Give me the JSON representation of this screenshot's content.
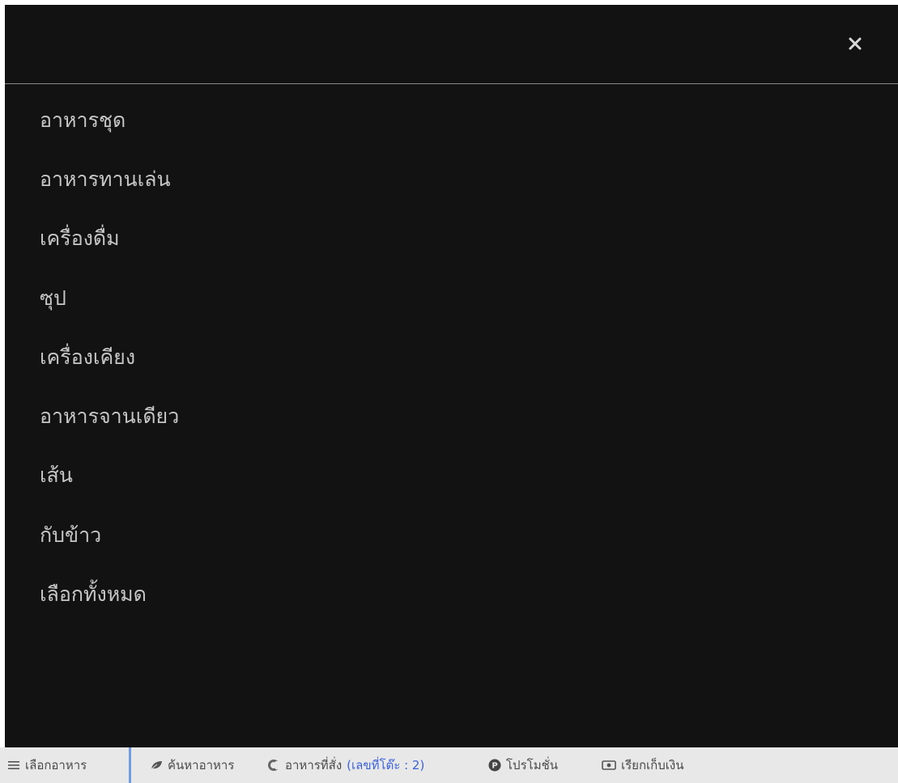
{
  "menu_panel": {
    "close_icon": "close-icon",
    "categories": [
      "อาหารชุด",
      "อาหารทานเล่น",
      "เครื่องดื่ม",
      "ซุป",
      "เครื่องเคียง",
      "อาหารจานเดียว",
      "เส้น",
      "กับข้าว",
      "เลือกทั้งหมด"
    ]
  },
  "bottom_nav": {
    "choose_food": {
      "icon": "hamburger-icon",
      "label": "เลือกอาหาร"
    },
    "search_food": {
      "icon": "leaf-icon",
      "label": "ค้นหาอาหาร"
    },
    "ordered_food": {
      "icon": "fork-icon",
      "label": "อาหารที่สั่ง",
      "table_number": "(เลขที่โต๊ะ : 2)"
    },
    "promotion": {
      "icon": "promotion-icon",
      "label": "โปรโมชั่น"
    },
    "call_bill": {
      "icon": "money-icon",
      "label": "เรียกเก็บเงิน"
    }
  },
  "colors": {
    "panel_bg": "#121212",
    "menu_text": "#c6c6c6",
    "bar_bg": "#e8e8e8",
    "accent": "#6f9be3",
    "table_no": "#3d63d8"
  }
}
